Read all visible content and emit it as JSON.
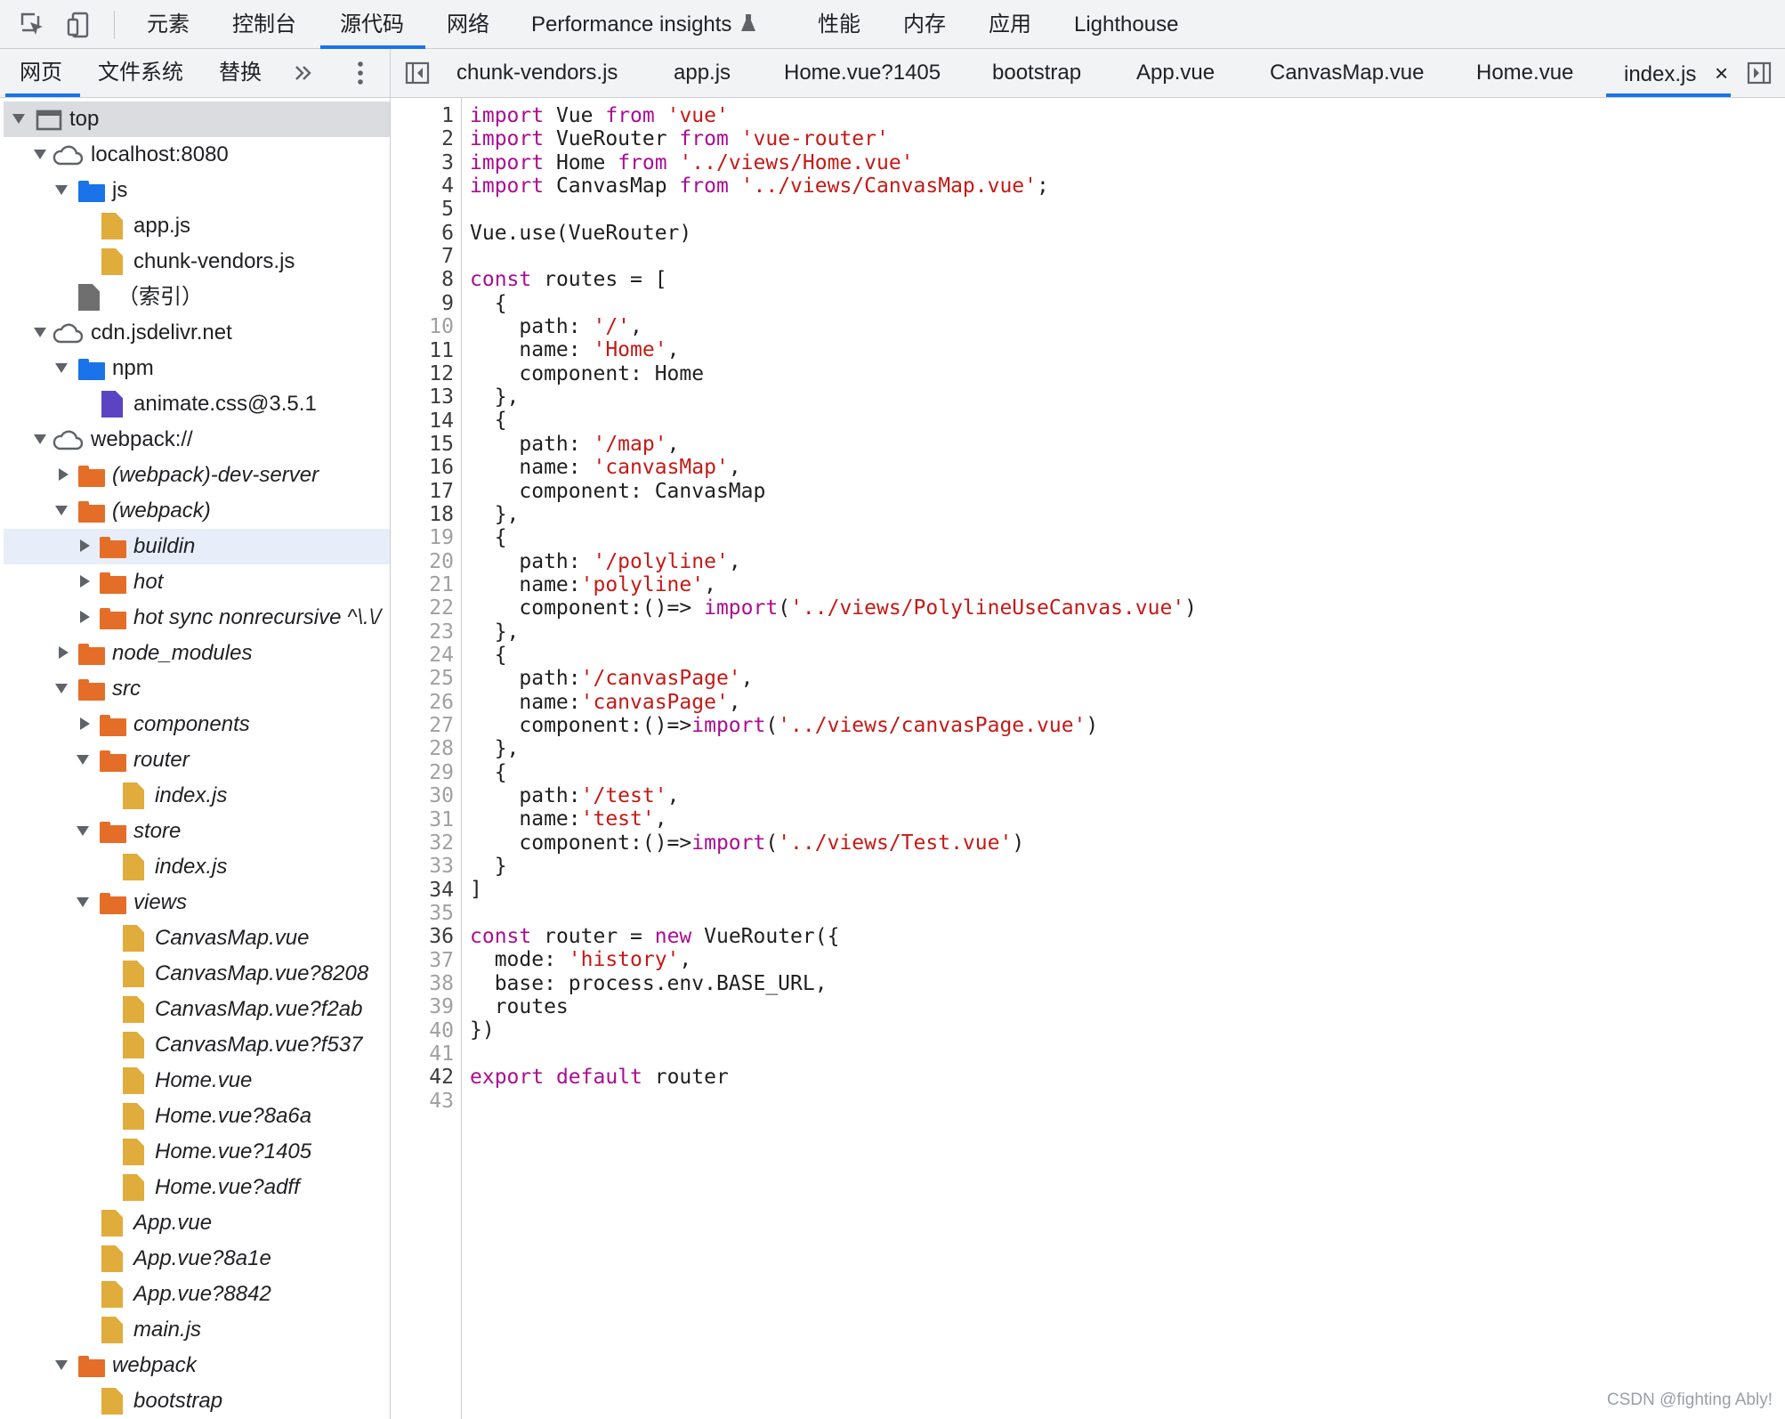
{
  "top_toolbar": {
    "tabs": [
      "元素",
      "控制台",
      "源代码",
      "网络",
      "Performance insights",
      "性能",
      "内存",
      "应用",
      "Lighthouse"
    ],
    "active_tab": "源代码"
  },
  "navigator": {
    "tabs": [
      "网页",
      "文件系统",
      "替换"
    ],
    "active_tab": "网页",
    "more_glyph": "»",
    "tree": [
      {
        "label": "top"
      },
      {
        "label": "localhost:8080"
      },
      {
        "label": "js"
      },
      {
        "label": "app.js"
      },
      {
        "label": "chunk-vendors.js"
      },
      {
        "label": "（索引）"
      },
      {
        "label": "cdn.jsdelivr.net"
      },
      {
        "label": "npm"
      },
      {
        "label": "animate.css@3.5.1"
      },
      {
        "label": "webpack://"
      },
      {
        "label": "(webpack)-dev-server"
      },
      {
        "label": "(webpack)"
      },
      {
        "label": "buildin"
      },
      {
        "label": "hot"
      },
      {
        "label": "hot sync nonrecursive ^\\.\\/"
      },
      {
        "label": "node_modules"
      },
      {
        "label": "src"
      },
      {
        "label": "components"
      },
      {
        "label": "router"
      },
      {
        "label": "index.js"
      },
      {
        "label": "store"
      },
      {
        "label": "index.js"
      },
      {
        "label": "views"
      },
      {
        "label": "CanvasMap.vue"
      },
      {
        "label": "CanvasMap.vue?8208"
      },
      {
        "label": "CanvasMap.vue?f2ab"
      },
      {
        "label": "CanvasMap.vue?f537"
      },
      {
        "label": "Home.vue"
      },
      {
        "label": "Home.vue?8a6a"
      },
      {
        "label": "Home.vue?1405"
      },
      {
        "label": "Home.vue?adff"
      },
      {
        "label": "App.vue"
      },
      {
        "label": "App.vue?8a1e"
      },
      {
        "label": "App.vue?8842"
      },
      {
        "label": "main.js"
      },
      {
        "label": "webpack"
      },
      {
        "label": "bootstrap"
      }
    ]
  },
  "editor": {
    "tabs": [
      "chunk-vendors.js",
      "app.js",
      "Home.vue?1405",
      "bootstrap",
      "App.vue",
      "CanvasMap.vue",
      "Home.vue",
      "index.js"
    ],
    "active_tab": "index.js",
    "close_glyph": "×",
    "line_numbers": [
      "1",
      "2",
      "3",
      "4",
      "5",
      "6",
      "7",
      "8",
      "9",
      "10",
      "11",
      "12",
      "13",
      "14",
      "15",
      "16",
      "17",
      "18",
      "19",
      "20",
      "21",
      "22",
      "23",
      "24",
      "25",
      "26",
      "27",
      "28",
      "29",
      "30",
      "31",
      "32",
      "33",
      "34",
      "35",
      "36",
      "37",
      "38",
      "39",
      "40",
      "41",
      "42",
      "43"
    ],
    "code_lines": [
      "import Vue from 'vue'",
      "import VueRouter from 'vue-router'",
      "import Home from '../views/Home.vue'",
      "import CanvasMap from '../views/CanvasMap.vue';",
      "",
      "Vue.use(VueRouter)",
      "",
      "const routes = [",
      "  {",
      "    path: '/',",
      "    name: 'Home',",
      "    component: Home",
      "  },",
      "  {",
      "    path: '/map',",
      "    name: 'canvasMap',",
      "    component: CanvasMap",
      "  },",
      "  {",
      "    path: '/polyline',",
      "    name:'polyline',",
      "    component:()=> import('../views/PolylineUseCanvas.vue')",
      "  },",
      "  {",
      "    path:'/canvasPage',",
      "    name:'canvasPage',",
      "    component:()=>import('../views/canvasPage.vue')",
      "  },",
      "  {",
      "    path:'/test',",
      "    name:'test',",
      "    component:()=>import('../views/Test.vue')",
      "  }",
      "]",
      "",
      "const router = new VueRouter({",
      "  mode: 'history',",
      "  base: process.env.BASE_URL,",
      "  routes",
      "})",
      "",
      "export default router",
      ""
    ]
  },
  "watermark": "CSDN @fighting Ably!",
  "colors": {
    "accent": "#1a73e8",
    "keyword": "#aa0d91",
    "string": "#c41a16",
    "folder_orange": "#e46e27",
    "folder_blue": "#1a73e8",
    "file_yellow": "#e0ac3b",
    "file_purple": "#5a44c4"
  }
}
